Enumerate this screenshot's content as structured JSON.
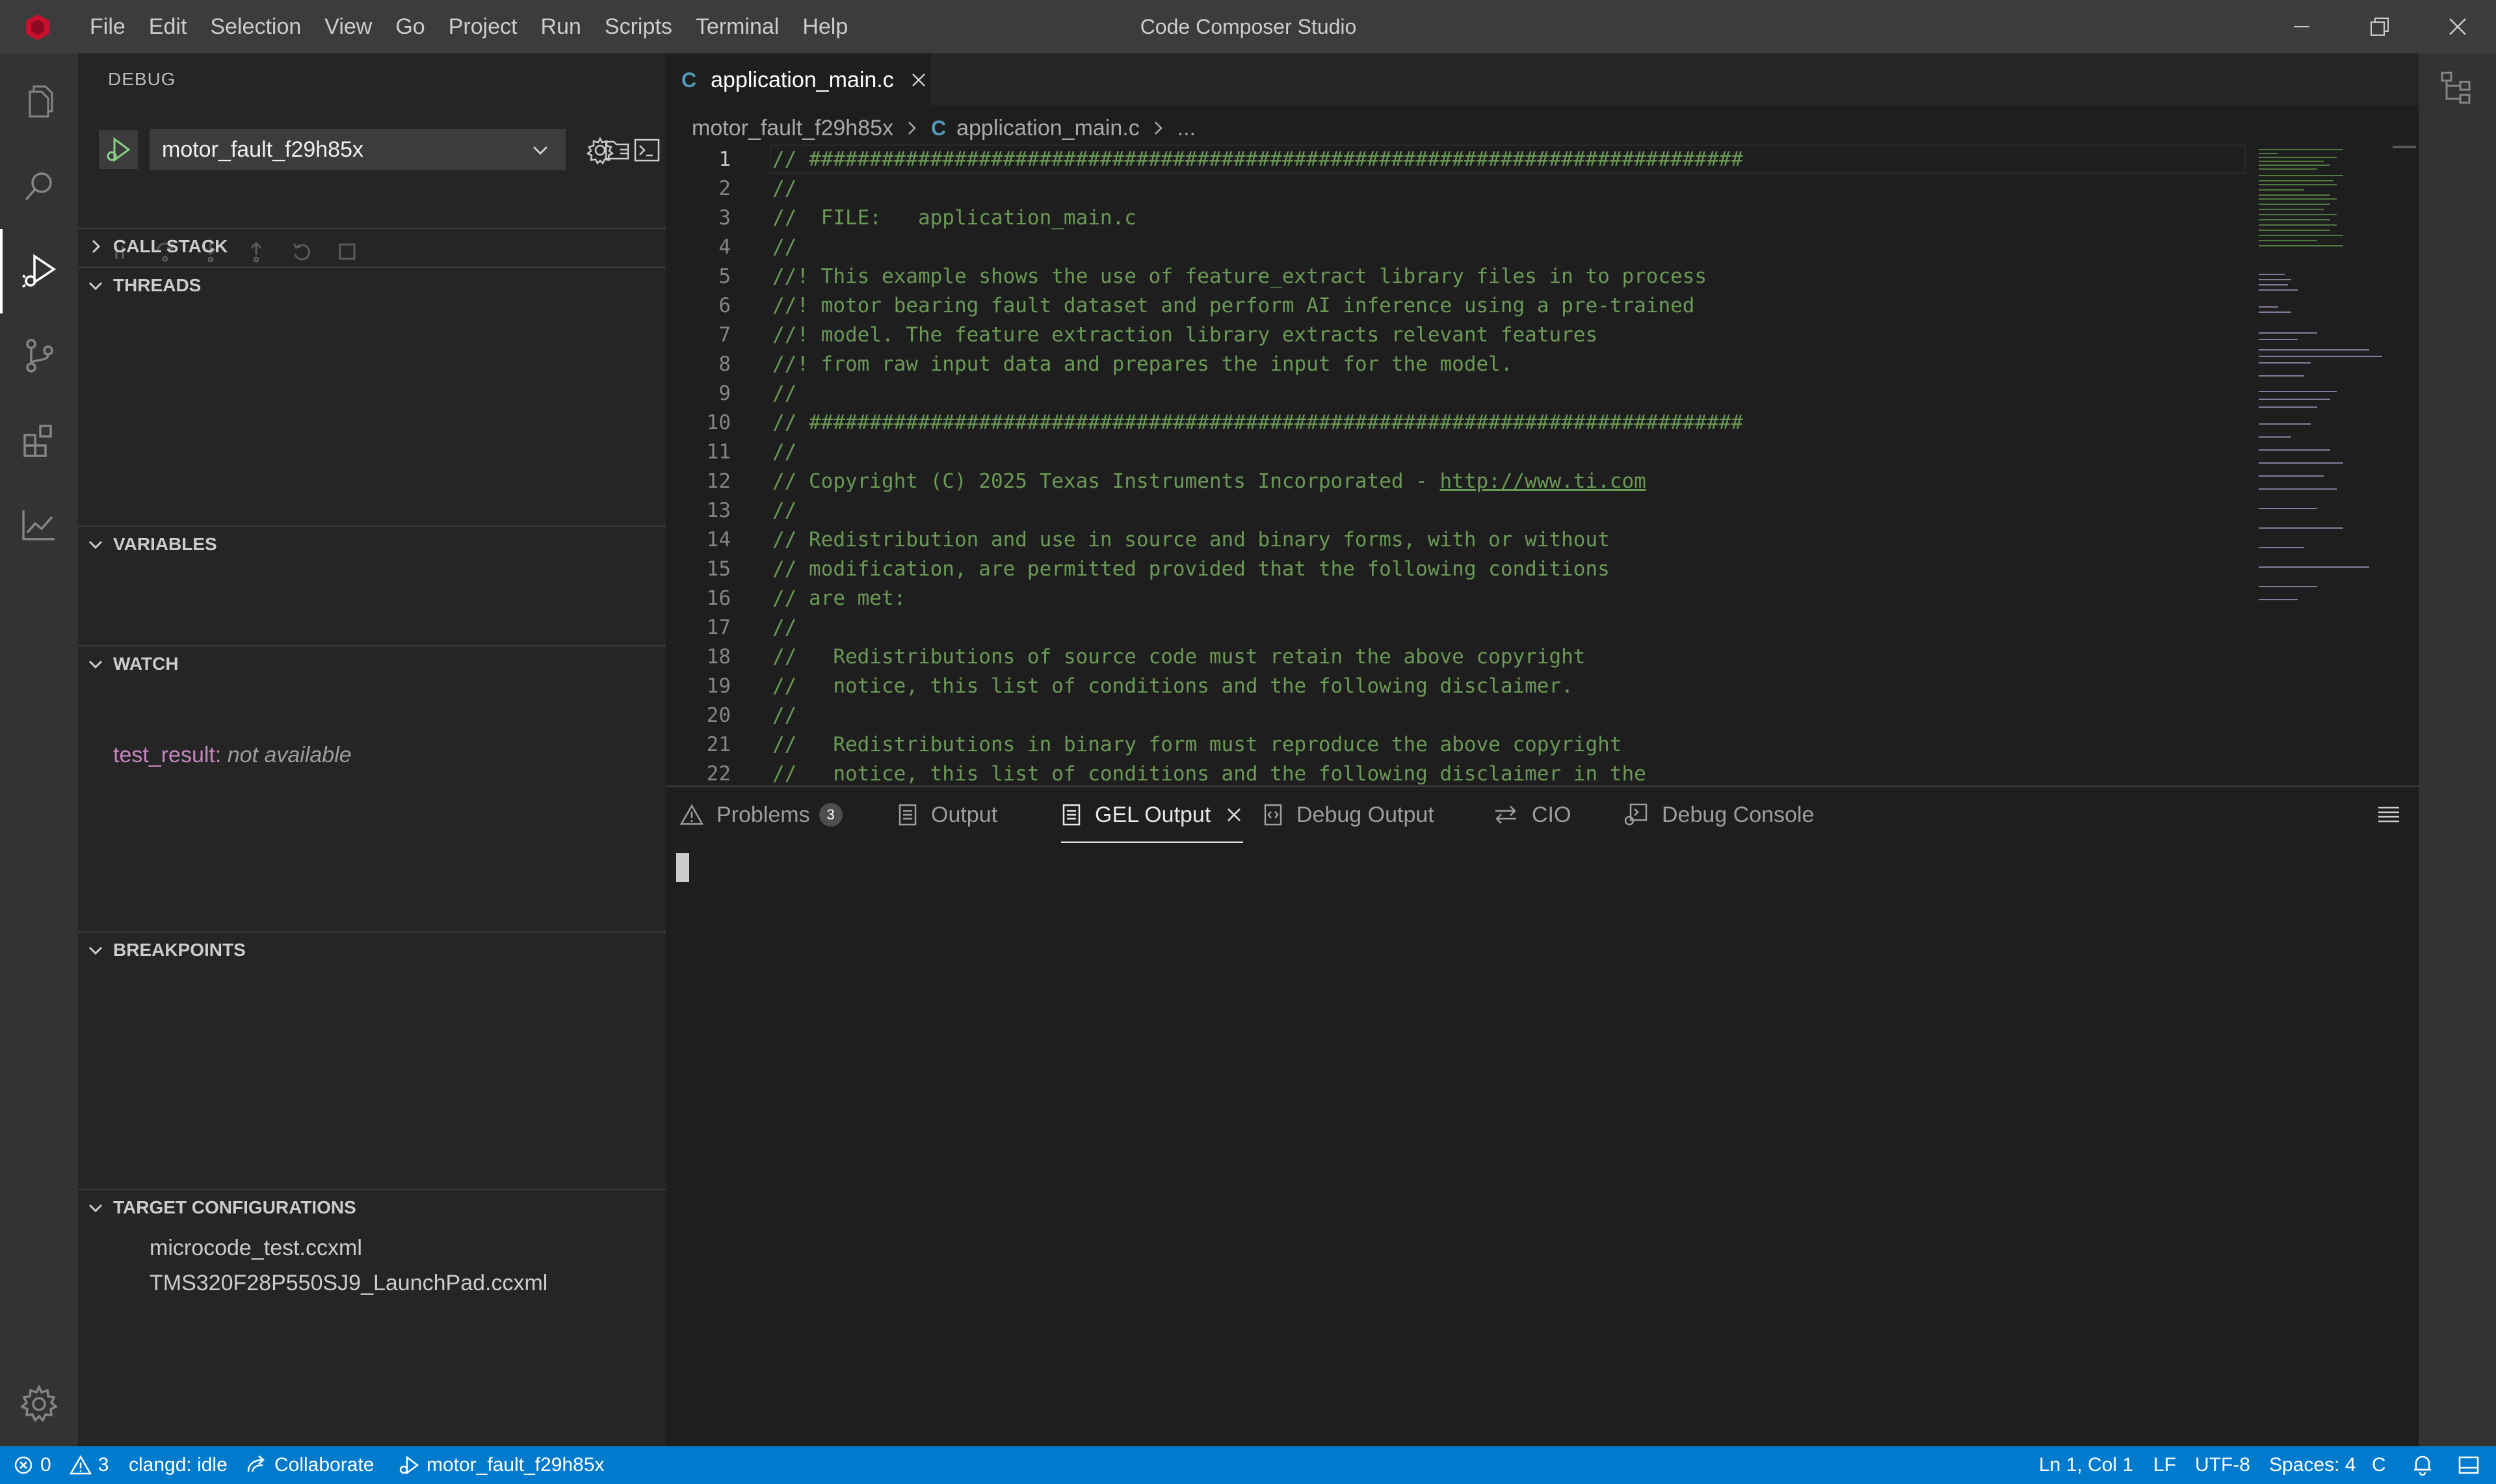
{
  "window": {
    "title": "Code Composer Studio"
  },
  "menu": [
    "File",
    "Edit",
    "Selection",
    "View",
    "Go",
    "Project",
    "Run",
    "Scripts",
    "Terminal",
    "Help"
  ],
  "sidebar": {
    "title": "DEBUG",
    "launch_config": "motor_fault_f29h85x",
    "sections": {
      "call_stack": "CALL STACK",
      "threads": "THREADS",
      "variables": "VARIABLES",
      "watch": "WATCH",
      "breakpoints": "BREAKPOINTS",
      "target_configurations": "TARGET CONFIGURATIONS"
    },
    "watch_items": [
      {
        "name": "test_result:",
        "value": "not available"
      }
    ],
    "target_configurations": [
      "microcode_test.ccxml",
      "TMS320F28P550SJ9_LaunchPad.ccxml"
    ]
  },
  "editor": {
    "tab": {
      "label": "application_main.c",
      "icon": "C"
    },
    "breadcrumb": [
      "motor_fault_f29h85x",
      "application_main.c",
      "..."
    ],
    "current_line": 1,
    "lines": [
      {
        "n": "1",
        "text": "// #############################################################################"
      },
      {
        "n": "2",
        "text": "//"
      },
      {
        "n": "3",
        "text": "//  FILE:   application_main.c"
      },
      {
        "n": "4",
        "text": "//"
      },
      {
        "n": "5",
        "text": "//! This example shows the use of feature_extract library files in to process"
      },
      {
        "n": "6",
        "text": "//! motor bearing fault dataset and perform AI inference using a pre-trained"
      },
      {
        "n": "7",
        "text": "//! model. The feature extraction library extracts relevant features"
      },
      {
        "n": "8",
        "text": "//! from raw input data and prepares the input for the model."
      },
      {
        "n": "9",
        "text": "//"
      },
      {
        "n": "10",
        "text": "// #############################################################################"
      },
      {
        "n": "11",
        "text": "//"
      },
      {
        "n": "12",
        "text": "// Copyright (C) 2025 Texas Instruments Incorporated - ",
        "link": "http://www.ti.com"
      },
      {
        "n": "13",
        "text": "//"
      },
      {
        "n": "14",
        "text": "// Redistribution and use in source and binary forms, with or without"
      },
      {
        "n": "15",
        "text": "// modification, are permitted provided that the following conditions"
      },
      {
        "n": "16",
        "text": "// are met:"
      },
      {
        "n": "17",
        "text": "//"
      },
      {
        "n": "18",
        "text": "//   Redistributions of source code must retain the above copyright"
      },
      {
        "n": "19",
        "text": "//   notice, this list of conditions and the following disclaimer."
      },
      {
        "n": "20",
        "text": "//"
      },
      {
        "n": "21",
        "text": "//   Redistributions in binary form must reproduce the above copyright"
      },
      {
        "n": "22",
        "text": "//   notice, this list of conditions and the following disclaimer in the"
      }
    ]
  },
  "panel": {
    "tabs": {
      "problems": "Problems",
      "problems_count": "3",
      "output": "Output",
      "gel_output": "GEL Output",
      "debug_output": "Debug Output",
      "cio": "CIO",
      "debug_console": "Debug Console"
    },
    "active_tab": "GEL Output"
  },
  "statusbar": {
    "errors": "0",
    "warnings": "3",
    "clangd": "clangd: idle",
    "collaborate": "Collaborate",
    "debug_target": "motor_fault_f29h85x",
    "cursor_position": "Ln 1, Col 1",
    "eol": "LF",
    "encoding": "UTF-8",
    "indent": "Spaces: 4",
    "language": "C"
  },
  "colors": {
    "accent": "#007acc",
    "comment": "#6a9955",
    "watch_name": "#c586c0",
    "logo": "#c8102e"
  }
}
